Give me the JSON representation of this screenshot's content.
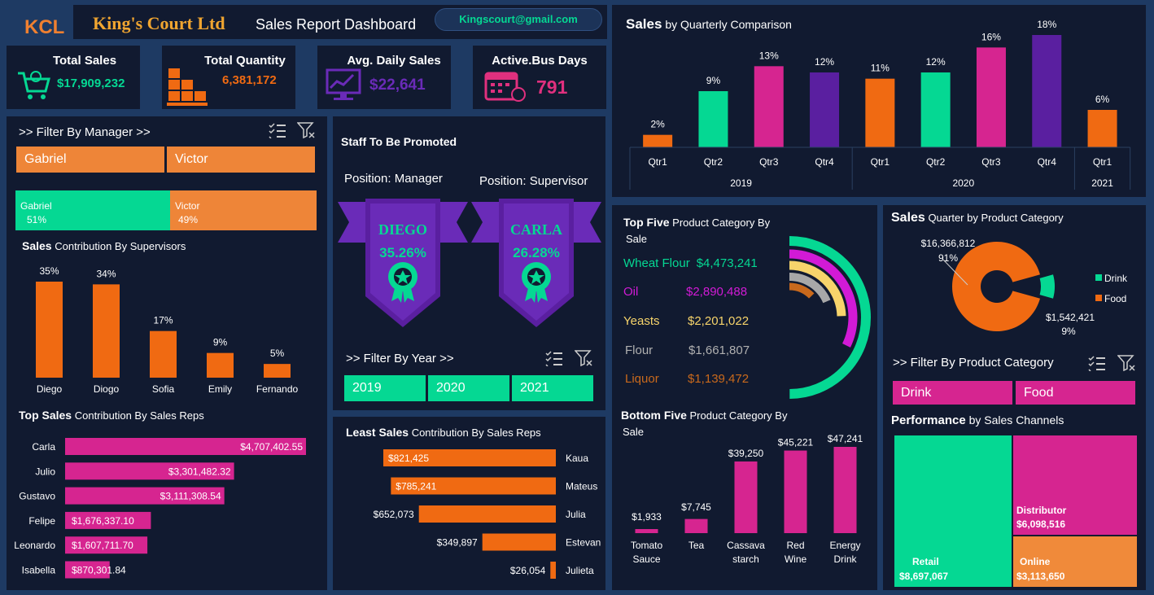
{
  "header": {
    "logo": "KCL",
    "company": "King's Court Ltd",
    "title": "Sales Report Dashboard",
    "email": "Kingscourt@gmail.com"
  },
  "colors": {
    "green": "#05d893",
    "orange": "#f06a12",
    "magenta": "#d62590",
    "purple": "#5a1fa0",
    "panel": "#111a30",
    "background": "#1e3a63"
  },
  "kpis": [
    {
      "label": "Total Sales",
      "value": "$17,909,232",
      "color": "#05d893",
      "icon": "shopping-cart-icon"
    },
    {
      "label": "Total Quantity",
      "value": "6,381,172",
      "color": "#f06a12",
      "icon": "boxes-icon"
    },
    {
      "label": "Avg. Daily Sales",
      "value": "$22,641",
      "color": "#6a2bb8",
      "icon": "chart-monitor-icon"
    },
    {
      "label": "Active.Bus Days",
      "value": "791",
      "color": "#e0307e",
      "icon": "calendar-icon"
    }
  ],
  "manager_filter": {
    "title": ">> Filter By Manager >>",
    "buttons": [
      "Gabriel",
      "Victor"
    ],
    "split": [
      {
        "name": "Gabriel",
        "pct": "51%",
        "value": 51
      },
      {
        "name": "Victor",
        "pct": "49%",
        "value": 49
      }
    ]
  },
  "supervisors": {
    "title_bold": "Sales",
    "title_rest": "Contribution By Supervisors"
  },
  "top_sales": {
    "title_bold": "Top Sales",
    "title_rest": "Contribution By Sales Reps"
  },
  "staff": {
    "title": "Staff To Be Promoted",
    "manager": {
      "position": "Position: Manager",
      "name": "DIEGO",
      "pct": "35.26%"
    },
    "supervisor": {
      "position": "Position: Supervisor",
      "name": "CARLA",
      "pct": "26.28%"
    }
  },
  "year_filter": {
    "title": ">> Filter By Year >>",
    "years": [
      "2019",
      "2020",
      "2021"
    ]
  },
  "least_sales": {
    "title_bold": "Least Sales",
    "title_rest": "Contribution By Sales Reps"
  },
  "quarterly": {
    "title_bold": "Sales",
    "title_rest": "by Quarterly Comparison"
  },
  "top_five": {
    "title_bold": "Top Five",
    "title_rest": "Product Category By",
    "title_line2": "Sale",
    "items": [
      {
        "name": "Wheat Flour",
        "value": "$4,473,241",
        "color": "#05d893"
      },
      {
        "name": "Oil",
        "value": "$2,890,488",
        "color": "#d21ad6"
      },
      {
        "name": "Yeasts",
        "value": "$2,201,022",
        "color": "#f7d46b"
      },
      {
        "name": "Flour",
        "value": "$1,661,807",
        "color": "#a8a8a8"
      },
      {
        "name": "Liquor",
        "value": "$1,139,472",
        "color": "#c9691c"
      }
    ]
  },
  "bottom_five": {
    "title_bold": "Bottom Five",
    "title_rest": "Product Category By",
    "title_line2": "Sale"
  },
  "quarter_category": {
    "title_bold": "Sales",
    "title_rest": "Quarter by Product Category"
  },
  "category_filter": {
    "title": ">> Filter By Product Category",
    "buttons": [
      "Drink",
      "Food"
    ]
  },
  "performance": {
    "title_bold": "Performance",
    "title_rest": "by Sales Channels",
    "channels": [
      {
        "name": "Retail",
        "value": "$8,697,067",
        "color": "#05d893"
      },
      {
        "name": "Distributor",
        "value": "$6,098,516",
        "color": "#d62590"
      },
      {
        "name": "Online",
        "value": "$3,113,650",
        "color": "#f08a3a"
      }
    ]
  },
  "chart_data": [
    {
      "type": "bar",
      "id": "supervisors",
      "categories": [
        "Diego",
        "Diogo",
        "Sofia",
        "Emily",
        "Fernando"
      ],
      "values": [
        35,
        34,
        17,
        9,
        5
      ],
      "labels": [
        "35%",
        "34%",
        "17%",
        "9%",
        "5%"
      ],
      "ylim": [
        0,
        35
      ]
    },
    {
      "type": "bar",
      "id": "top_sales_reps",
      "orientation": "horizontal",
      "categories": [
        "Carla",
        "Julio",
        "Gustavo",
        "Felipe",
        "Leonardo",
        "Isabella"
      ],
      "values": [
        4707402.55,
        3301482.32,
        3111308.54,
        1676337.1,
        1607711.7,
        870301.84
      ],
      "labels": [
        "$4,707,402.55",
        "$3,301,482.32",
        "$3,111,308.54",
        "$1,676,337.10",
        "$1,607,711.70",
        "$870,301.84"
      ]
    },
    {
      "type": "bar",
      "id": "least_sales_reps",
      "orientation": "horizontal",
      "categories": [
        "Kaua",
        "Mateus",
        "Julia",
        "Estevan",
        "Julieta"
      ],
      "values": [
        821425,
        785241,
        652073,
        349897,
        26054
      ],
      "labels": [
        "$821,425",
        "$785,241",
        "$652,073",
        "$349,897",
        "$26,054"
      ]
    },
    {
      "type": "bar",
      "id": "quarterly",
      "categories": [
        "Qtr1",
        "Qtr2",
        "Qtr3",
        "Qtr4",
        "Qtr1",
        "Qtr2",
        "Qtr3",
        "Qtr4",
        "Qtr1"
      ],
      "groups": [
        {
          "label": "2019",
          "count": 4
        },
        {
          "label": "2020",
          "count": 4
        },
        {
          "label": "2021",
          "count": 1
        }
      ],
      "values": [
        2,
        9,
        13,
        12,
        11,
        12,
        16,
        18,
        6
      ],
      "labels": [
        "2%",
        "9%",
        "13%",
        "12%",
        "11%",
        "12%",
        "16%",
        "18%",
        "6%"
      ],
      "colors": [
        "#f06a12",
        "#05d893",
        "#d62590",
        "#5a1fa0",
        "#f06a12",
        "#05d893",
        "#d62590",
        "#5a1fa0",
        "#f06a12"
      ]
    },
    {
      "type": "pie",
      "id": "top_five_radial",
      "categories": [
        "Wheat Flour",
        "Oil",
        "Yeasts",
        "Flour",
        "Liquor"
      ],
      "values": [
        4473241,
        2890488,
        2201022,
        1661807,
        1139472
      ]
    },
    {
      "type": "bar",
      "id": "bottom_five",
      "categories": [
        "Tomato Sauce",
        "Tea",
        "Cassava starch",
        "Red Wine",
        "Energy Drink"
      ],
      "values": [
        1933,
        7745,
        39250,
        45221,
        47241
      ],
      "labels": [
        "$1,933",
        "$7,745",
        "$39,250",
        "$45,221",
        "$47,241"
      ]
    },
    {
      "type": "pie",
      "id": "drink_food",
      "categories": [
        "Drink",
        "Food"
      ],
      "values": [
        1542421,
        16366812
      ],
      "labels": [
        "$1,542,421",
        "$16,366,812"
      ],
      "pcts": [
        "9%",
        "91%"
      ],
      "legend": "right"
    }
  ]
}
